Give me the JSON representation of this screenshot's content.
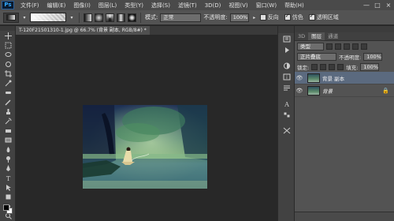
{
  "app": {
    "logo_text": "Ps"
  },
  "menu": [
    "文件(F)",
    "编辑(E)",
    "图像(I)",
    "图层(L)",
    "类型(Y)",
    "选择(S)",
    "滤镜(T)",
    "3D(D)",
    "视图(V)",
    "窗口(W)",
    "帮助(H)"
  ],
  "window_controls": [
    "—",
    "□",
    "×"
  ],
  "options_bar": {
    "mode_label": "模式:",
    "mode_value": "正常",
    "opacity_label": "不透明度:",
    "opacity_value": "100%",
    "reverse_label": "反向",
    "dither_label": "仿色",
    "transparency_label": "透明区域",
    "reverse_checked": false,
    "dither_checked": true,
    "transparency_checked": true
  },
  "document": {
    "tab_title": "T-120F21501310-1.jpg @ 66.7% (背景 副本, RGB/8#) *"
  },
  "layers_panel": {
    "header_tabs": [
      "图层",
      "通道"
    ],
    "extra_tab": "3D",
    "filter_label": "类型",
    "blend_mode": "正片叠底",
    "opacity_label": "不透明度:",
    "opacity_value": "100%",
    "lock_label": "锁定:",
    "fill_label": "填充:",
    "fill_value": "100%",
    "layers": [
      {
        "name": "背景 副本",
        "selected": true,
        "italic": false,
        "locked": false
      },
      {
        "name": "背景",
        "selected": false,
        "italic": true,
        "locked": true
      }
    ]
  },
  "colors": {
    "foreground": "#000000",
    "background": "#ffffff",
    "accent": "#31a8ff"
  },
  "icons": {
    "tools": [
      "move-icon",
      "marquee-icon",
      "lasso-icon",
      "quick-select-icon",
      "crop-icon",
      "eyedropper-icon",
      "healing-icon",
      "brush-icon",
      "clone-stamp-icon",
      "history-brush-icon",
      "eraser-icon",
      "gradient-icon",
      "blur-icon",
      "dodge-icon",
      "pen-icon",
      "type-icon",
      "path-select-icon",
      "shape-icon",
      "hand-icon",
      "zoom-icon"
    ]
  }
}
